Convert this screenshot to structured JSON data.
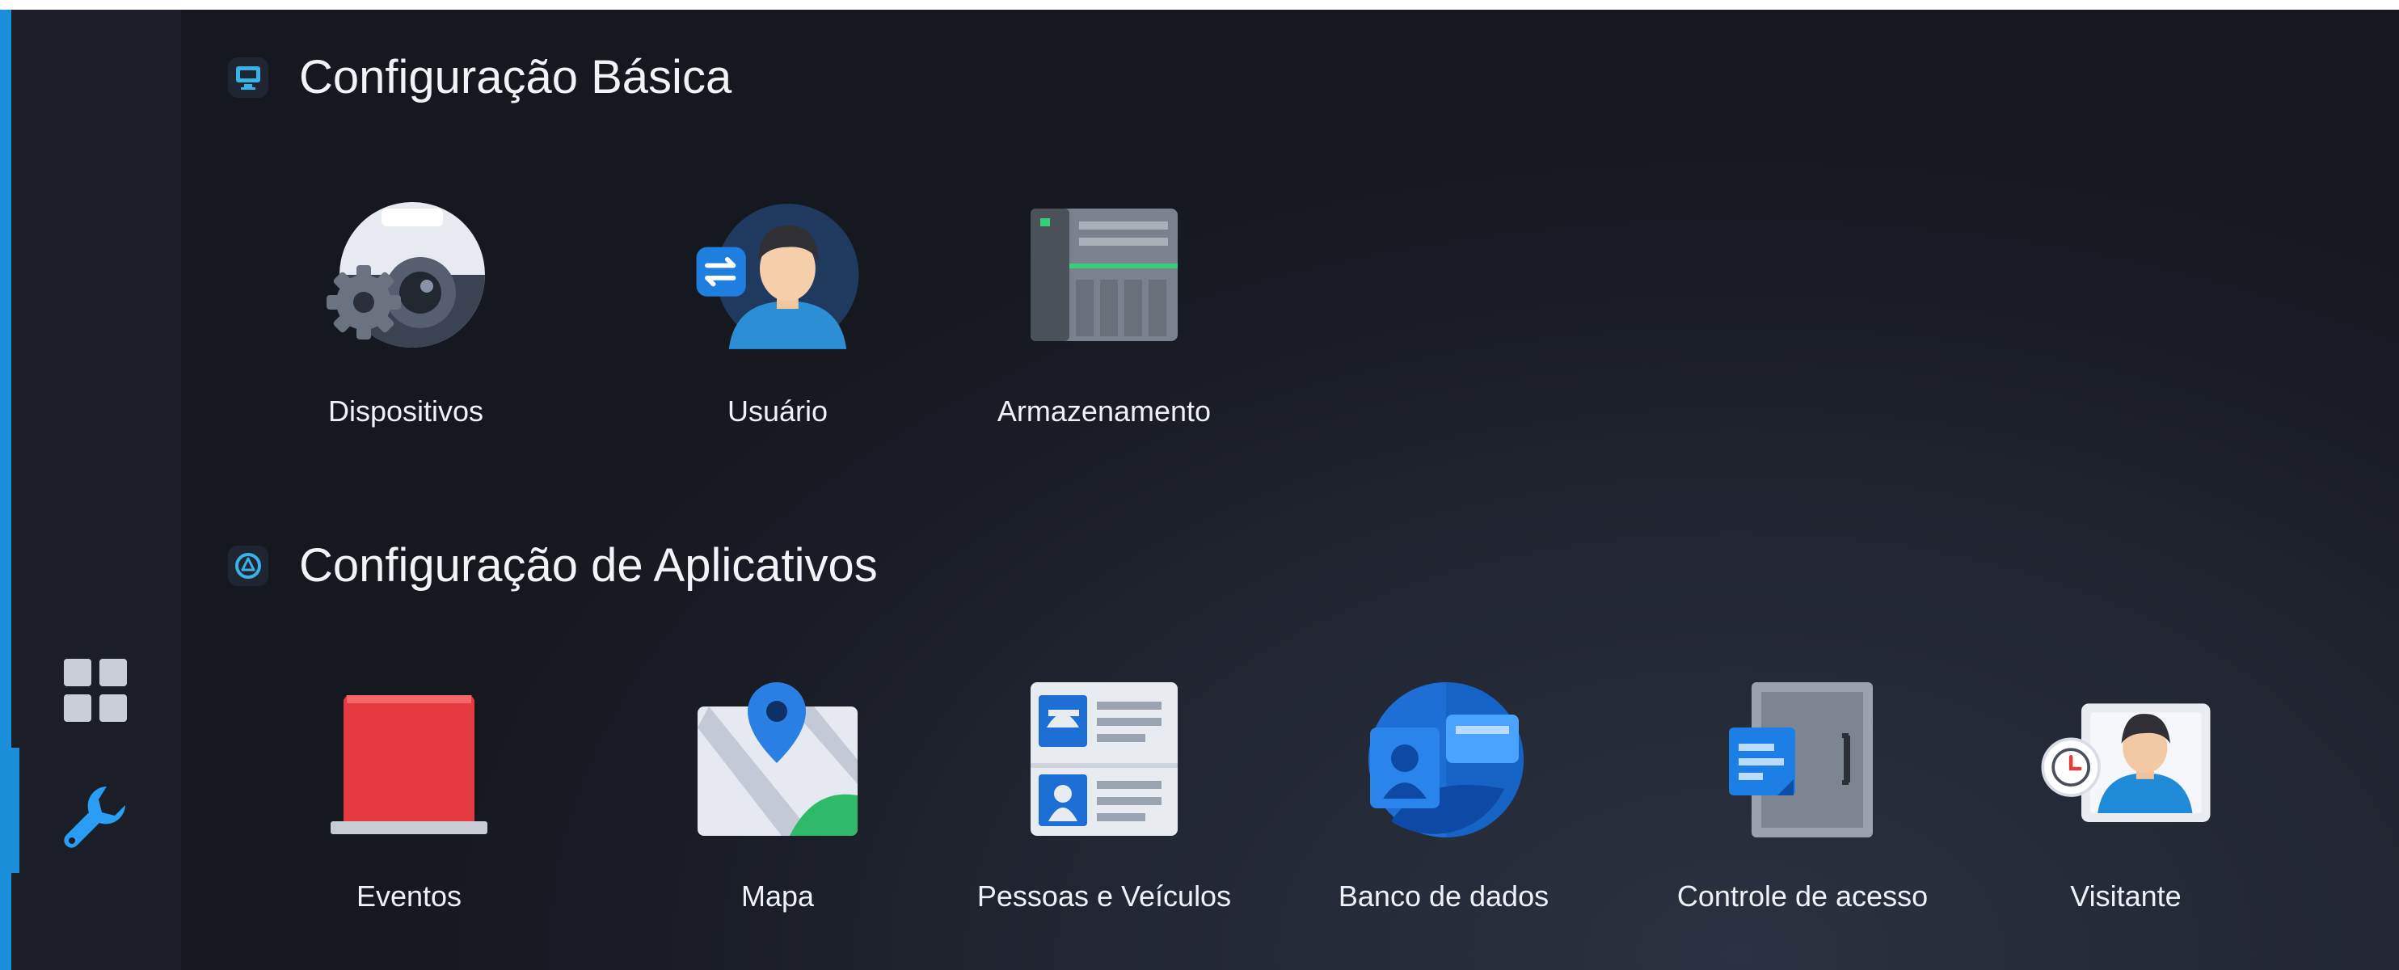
{
  "sections": [
    {
      "title": "Configuração Básica",
      "items": [
        {
          "label": "Dispositivos",
          "icon": "camera-gear-icon"
        },
        {
          "label": "Usuário",
          "icon": "user-switch-icon"
        },
        {
          "label": "Armazenamento",
          "icon": "storage-server-icon"
        }
      ]
    },
    {
      "title": "Configuração de Aplicativos",
      "items": [
        {
          "label": "Eventos",
          "icon": "alarm-light-icon"
        },
        {
          "label": "Mapa",
          "icon": "map-pin-icon"
        },
        {
          "label": "Pessoas e Veículos",
          "icon": "id-cards-icon"
        },
        {
          "label": "Banco de dados",
          "icon": "database-profile-icon"
        },
        {
          "label": "Controle de acesso",
          "icon": "access-door-icon"
        },
        {
          "label": "Visitante",
          "icon": "visitor-clock-icon"
        }
      ]
    }
  ],
  "rail": [
    {
      "icon": "grid-icon",
      "active": false
    },
    {
      "icon": "wrench-icon",
      "active": true
    }
  ],
  "colors": {
    "accent": "#1a8ed8",
    "background": "#1a1d26"
  }
}
